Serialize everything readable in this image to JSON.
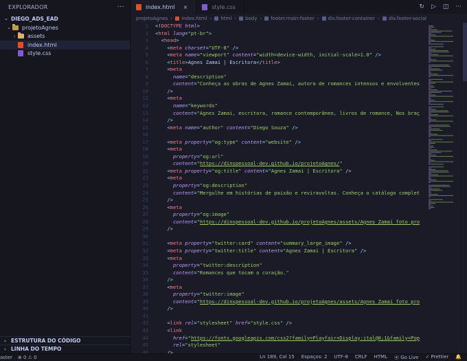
{
  "sidebar": {
    "title": "EXPLORADOR",
    "more": "···",
    "workspace": "DIEGO_ADS_EAD",
    "folder": "projetoAgnes",
    "children": [
      {
        "label": "assets",
        "type": "folder"
      },
      {
        "label": "index.html",
        "type": "html"
      },
      {
        "label": "style.css",
        "type": "css"
      }
    ],
    "outline": "ESTRUTURA DO CÓDIGO",
    "timeline": "LINHA DO TEMPO"
  },
  "tabs": [
    {
      "label": "index.html",
      "active": true,
      "type": "html",
      "close": "×"
    },
    {
      "label": "style.css",
      "active": false,
      "type": "css"
    }
  ],
  "tab_actions": [
    "↻",
    "▷",
    "◫",
    "···"
  ],
  "breadcrumb": [
    "projetoAgnes",
    "index.html",
    "html",
    "body",
    "footer.main-footer",
    "div.footer-container",
    "div.footer-social"
  ],
  "editor": {
    "lines": [
      [
        [
          "p",
          "<!"
        ],
        [
          "t",
          "DOCTYPE"
        ],
        [
          "a",
          " html"
        ],
        [
          "p",
          ">"
        ]
      ],
      [
        [
          "p",
          "<"
        ],
        [
          "t",
          "html"
        ],
        [
          "a",
          " lang"
        ],
        [
          "p",
          "="
        ],
        [
          "s",
          "\"pt-br\""
        ],
        [
          "p",
          ">"
        ]
      ],
      [
        [
          "x",
          "  "
        ],
        [
          "p",
          "<"
        ],
        [
          "t",
          "head"
        ],
        [
          "p",
          ">"
        ]
      ],
      [
        [
          "x",
          "    "
        ],
        [
          "p",
          "<"
        ],
        [
          "t",
          "meta"
        ],
        [
          "a",
          " charset"
        ],
        [
          "p",
          "="
        ],
        [
          "s",
          "\"UTF-8\""
        ],
        [
          "p",
          " />"
        ]
      ],
      [
        [
          "x",
          "    "
        ],
        [
          "p",
          "<"
        ],
        [
          "t",
          "meta"
        ],
        [
          "a",
          " name"
        ],
        [
          "p",
          "="
        ],
        [
          "s",
          "\"viewport\""
        ],
        [
          "a",
          " content"
        ],
        [
          "p",
          "="
        ],
        [
          "s",
          "\"width=device-width, initial-scale=1.0\""
        ],
        [
          "p",
          " />"
        ]
      ],
      [
        [
          "x",
          "    "
        ],
        [
          "p",
          "<"
        ],
        [
          "t",
          "title"
        ],
        [
          "p",
          ">"
        ],
        [
          "x",
          "Agnes Zamai | Escritora"
        ],
        [
          "p",
          "</"
        ],
        [
          "t",
          "title"
        ],
        [
          "p",
          ">"
        ]
      ],
      [
        [
          "x",
          "    "
        ],
        [
          "p",
          "<"
        ],
        [
          "t",
          "meta"
        ]
      ],
      [
        [
          "x",
          "      "
        ],
        [
          "a",
          "name"
        ],
        [
          "p",
          "="
        ],
        [
          "s",
          "\"description\""
        ]
      ],
      [
        [
          "x",
          "      "
        ],
        [
          "a",
          "content"
        ],
        [
          "p",
          "="
        ],
        [
          "s",
          "\"Conheça as obras de Agnes Zamai, autora de romances intensos e envolventes"
        ]
      ],
      [
        [
          "x",
          "    "
        ],
        [
          "p",
          "/>"
        ]
      ],
      [
        [
          "x",
          "    "
        ],
        [
          "p",
          "<"
        ],
        [
          "t",
          "meta"
        ]
      ],
      [
        [
          "x",
          "      "
        ],
        [
          "a",
          "name"
        ],
        [
          "p",
          "="
        ],
        [
          "s",
          "\"keywords\""
        ]
      ],
      [
        [
          "x",
          "      "
        ],
        [
          "a",
          "content"
        ],
        [
          "p",
          "="
        ],
        [
          "s",
          "\"Agnes Zamai, escritora, romance contemporâneo, livros de romance, Nos braç"
        ]
      ],
      [
        [
          "x",
          "    "
        ],
        [
          "p",
          "/>"
        ]
      ],
      [
        [
          "x",
          "    "
        ],
        [
          "p",
          "<"
        ],
        [
          "t",
          "meta"
        ],
        [
          "a",
          " name"
        ],
        [
          "p",
          "="
        ],
        [
          "s",
          "\"author\""
        ],
        [
          "a",
          " content"
        ],
        [
          "p",
          "="
        ],
        [
          "s",
          "\"Diego Souza\""
        ],
        [
          "p",
          " />"
        ]
      ],
      [
        [
          "x",
          ""
        ]
      ],
      [
        [
          "x",
          "    "
        ],
        [
          "p",
          "<"
        ],
        [
          "t",
          "meta"
        ],
        [
          "a",
          " property"
        ],
        [
          "p",
          "="
        ],
        [
          "s",
          "\"og:type\""
        ],
        [
          "a",
          " content"
        ],
        [
          "p",
          "="
        ],
        [
          "s",
          "\"website\""
        ],
        [
          "p",
          " />"
        ]
      ],
      [
        [
          "x",
          "    "
        ],
        [
          "p",
          "<"
        ],
        [
          "t",
          "meta"
        ]
      ],
      [
        [
          "x",
          "      "
        ],
        [
          "a",
          "property"
        ],
        [
          "p",
          "="
        ],
        [
          "s",
          "\"og:url\""
        ]
      ],
      [
        [
          "x",
          "      "
        ],
        [
          "a",
          "content"
        ],
        [
          "p",
          "="
        ],
        [
          "s",
          "\""
        ],
        [
          "u",
          "https://dinspessoal-dev.github.io/projetoAgnes/"
        ],
        [
          "s",
          "\""
        ]
      ],
      [
        [
          "x",
          "    "
        ],
        [
          "p",
          "<"
        ],
        [
          "t",
          "meta"
        ],
        [
          "a",
          " property"
        ],
        [
          "p",
          "="
        ],
        [
          "s",
          "\"og:title\""
        ],
        [
          "a",
          " content"
        ],
        [
          "p",
          "="
        ],
        [
          "s",
          "\"Agnes Zamai | Escritora\""
        ],
        [
          "p",
          " />"
        ]
      ],
      [
        [
          "x",
          "    "
        ],
        [
          "p",
          "<"
        ],
        [
          "t",
          "meta"
        ]
      ],
      [
        [
          "x",
          "      "
        ],
        [
          "a",
          "property"
        ],
        [
          "p",
          "="
        ],
        [
          "s",
          "\"og:description\""
        ]
      ],
      [
        [
          "x",
          "      "
        ],
        [
          "a",
          "content"
        ],
        [
          "p",
          "="
        ],
        [
          "s",
          "\"Mergulhe em histórias de paixão e reviravoltas. Conheça o catálogo complet"
        ]
      ],
      [
        [
          "x",
          "    "
        ],
        [
          "p",
          "/>"
        ]
      ],
      [
        [
          "x",
          "    "
        ],
        [
          "p",
          "<"
        ],
        [
          "t",
          "meta"
        ]
      ],
      [
        [
          "x",
          "      "
        ],
        [
          "a",
          "property"
        ],
        [
          "p",
          "="
        ],
        [
          "s",
          "\"og:image\""
        ]
      ],
      [
        [
          "x",
          "      "
        ],
        [
          "a",
          "content"
        ],
        [
          "p",
          "="
        ],
        [
          "s",
          "\""
        ],
        [
          "u",
          "https://dinspessoal-dev.github.io/projetoAgnes/assets/Agnes_Zamai_foto_pro"
        ]
      ],
      [
        [
          "x",
          "    "
        ],
        [
          "p",
          "/>"
        ]
      ],
      [
        [
          "x",
          ""
        ]
      ],
      [
        [
          "x",
          "    "
        ],
        [
          "p",
          "<"
        ],
        [
          "t",
          "meta"
        ],
        [
          "a",
          " property"
        ],
        [
          "p",
          "="
        ],
        [
          "s",
          "\"twitter:card\""
        ],
        [
          "a",
          " content"
        ],
        [
          "p",
          "="
        ],
        [
          "s",
          "\"summary_large_image\""
        ],
        [
          "p",
          " />"
        ]
      ],
      [
        [
          "x",
          "    "
        ],
        [
          "p",
          "<"
        ],
        [
          "t",
          "meta"
        ],
        [
          "a",
          " property"
        ],
        [
          "p",
          "="
        ],
        [
          "s",
          "\"twitter:title\""
        ],
        [
          "a",
          " content"
        ],
        [
          "p",
          "="
        ],
        [
          "s",
          "\"Agnes Zamai | Escritora\""
        ],
        [
          "p",
          " />"
        ]
      ],
      [
        [
          "x",
          "    "
        ],
        [
          "p",
          "<"
        ],
        [
          "t",
          "meta"
        ]
      ],
      [
        [
          "x",
          "      "
        ],
        [
          "a",
          "property"
        ],
        [
          "p",
          "="
        ],
        [
          "s",
          "\"twitter:description\""
        ]
      ],
      [
        [
          "x",
          "      "
        ],
        [
          "a",
          "content"
        ],
        [
          "p",
          "="
        ],
        [
          "s",
          "\"Romances que tocam o coração.\""
        ]
      ],
      [
        [
          "x",
          "    "
        ],
        [
          "p",
          "/>"
        ]
      ],
      [
        [
          "x",
          "    "
        ],
        [
          "p",
          "<"
        ],
        [
          "t",
          "meta"
        ]
      ],
      [
        [
          "x",
          "      "
        ],
        [
          "a",
          "property"
        ],
        [
          "p",
          "="
        ],
        [
          "s",
          "\"twitter:image\""
        ]
      ],
      [
        [
          "x",
          "      "
        ],
        [
          "a",
          "content"
        ],
        [
          "p",
          "="
        ],
        [
          "s",
          "\""
        ],
        [
          "u",
          "https://dinspessoal-dev.github.io/projetoAgnes/assets/Agnes_Zamai_foto_pro"
        ]
      ],
      [
        [
          "x",
          "    "
        ],
        [
          "p",
          "/>"
        ]
      ],
      [
        [
          "x",
          ""
        ]
      ],
      [
        [
          "x",
          "    "
        ],
        [
          "p",
          "<"
        ],
        [
          "t",
          "link"
        ],
        [
          "a",
          " rel"
        ],
        [
          "p",
          "="
        ],
        [
          "s",
          "\"stylesheet\""
        ],
        [
          "a",
          " href"
        ],
        [
          "p",
          "="
        ],
        [
          "s",
          "\"style.css\""
        ],
        [
          "p",
          " />"
        ]
      ],
      [
        [
          "x",
          "    "
        ],
        [
          "p",
          "<"
        ],
        [
          "t",
          "link"
        ]
      ],
      [
        [
          "x",
          "      "
        ],
        [
          "a",
          "href"
        ],
        [
          "p",
          "="
        ],
        [
          "s",
          "\""
        ],
        [
          "u",
          "https://fonts.googleapis.com/css2?family=Playfair+Display:ital@0;1&family=Pop"
        ]
      ],
      [
        [
          "x",
          "      "
        ],
        [
          "a",
          "rel"
        ],
        [
          "p",
          "="
        ],
        [
          "s",
          "\"stylesheet\""
        ]
      ],
      [
        [
          "x",
          "    "
        ],
        [
          "p",
          "/>"
        ]
      ]
    ]
  },
  "statusbar": {
    "left": [
      "aster",
      "⊗ 0 ⚠ 0"
    ],
    "right": [
      "Ln 189, Col 15",
      "Espaços: 2",
      "UTF-8",
      "CRLF",
      "HTML",
      "⦿ Go Live",
      "✓ Prettier",
      "🔔"
    ]
  },
  "colors": {
    "accent": "#7aa2f7",
    "background": "#1a1b26",
    "sidebar": "#16161e"
  }
}
